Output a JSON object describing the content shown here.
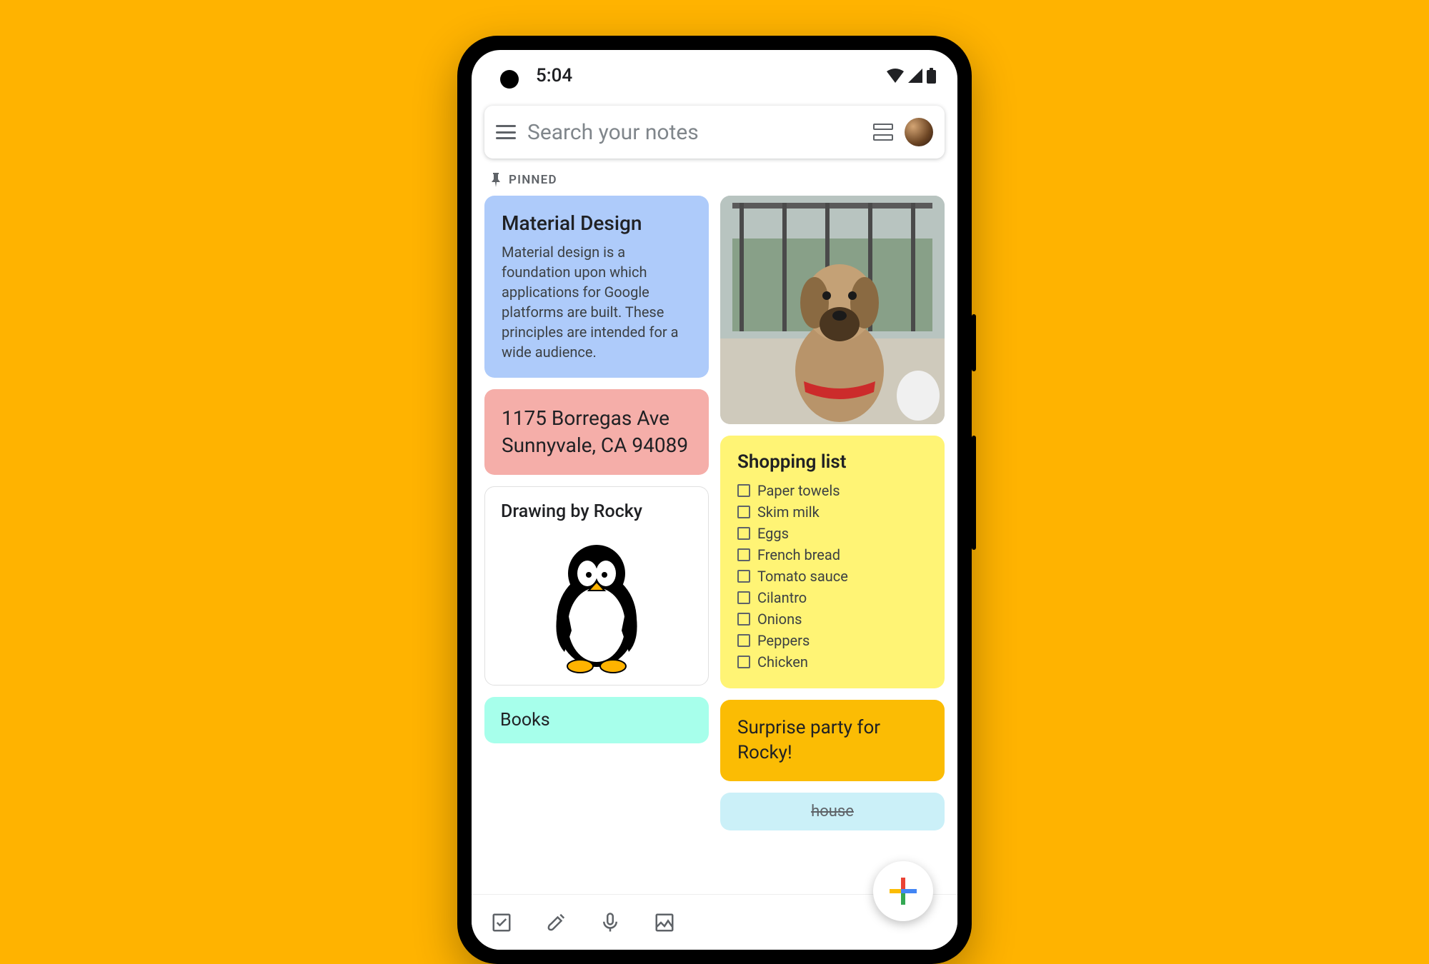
{
  "status": {
    "time": "5:04"
  },
  "search": {
    "placeholder": "Search your notes"
  },
  "section": {
    "pinned_label": "PINNED"
  },
  "notes": {
    "material": {
      "title": "Material Design",
      "body": "Material design is a foundation upon which applications for Google platforms are built. These principles are intended for a wide audience."
    },
    "address": {
      "line": "1175 Borregas Ave Sunnyvale, CA 94089"
    },
    "drawing": {
      "title": "Drawing by Rocky"
    },
    "books_partial": "Books",
    "shopping": {
      "title": "Shopping list",
      "items": [
        "Paper towels",
        "Skim milk",
        "Eggs",
        "French bread",
        "Tomato sauce",
        "Cilantro",
        "Onions",
        "Peppers",
        "Chicken"
      ]
    },
    "surprise": {
      "body": "Surprise party for Rocky!"
    },
    "lblue_partial": "house"
  }
}
